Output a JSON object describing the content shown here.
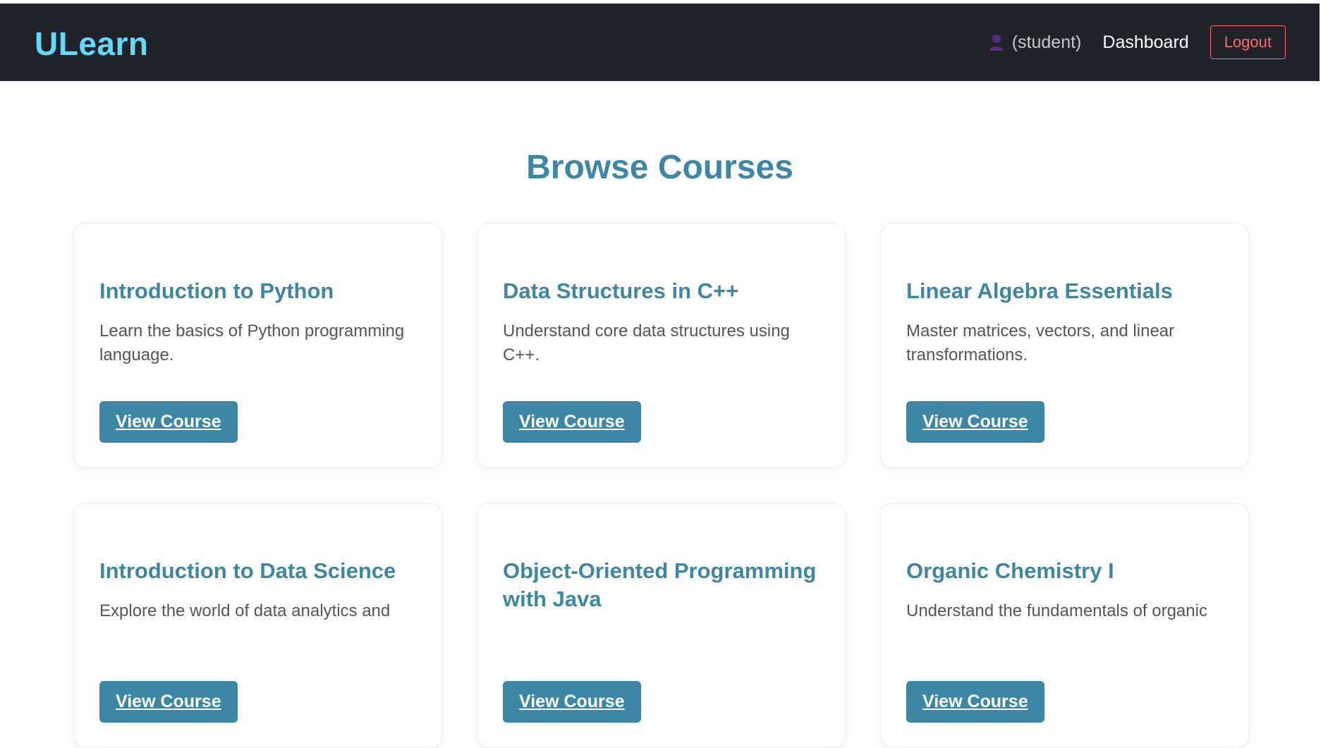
{
  "header": {
    "brand": "ULearn",
    "user_icon": "user-icon",
    "user_role": "(student)",
    "dashboard_label": "Dashboard",
    "logout_label": "Logout"
  },
  "main": {
    "title": "Browse Courses",
    "courses": [
      {
        "title": "Introduction to Python",
        "description": "Learn the basics of Python programming language.",
        "button": "View Course"
      },
      {
        "title": "Data Structures in C++",
        "description": "Understand core data structures using C++.",
        "button": "View Course"
      },
      {
        "title": "Linear Algebra Essentials",
        "description": "Master matrices, vectors, and linear transformations.",
        "button": "View Course"
      },
      {
        "title": "Introduction to Data Science",
        "description": "Explore the world of data analytics and",
        "button": "View Course"
      },
      {
        "title": "Object-Oriented Programming with Java",
        "description": "",
        "button": "View Course"
      },
      {
        "title": "Organic Chemistry I",
        "description": "Understand the fundamentals of organic",
        "button": "View Course"
      }
    ]
  },
  "colors": {
    "header_bg": "#20232a",
    "brand": "#61dafb",
    "accent": "#3d87a6",
    "logout": "#ff6b6b"
  }
}
